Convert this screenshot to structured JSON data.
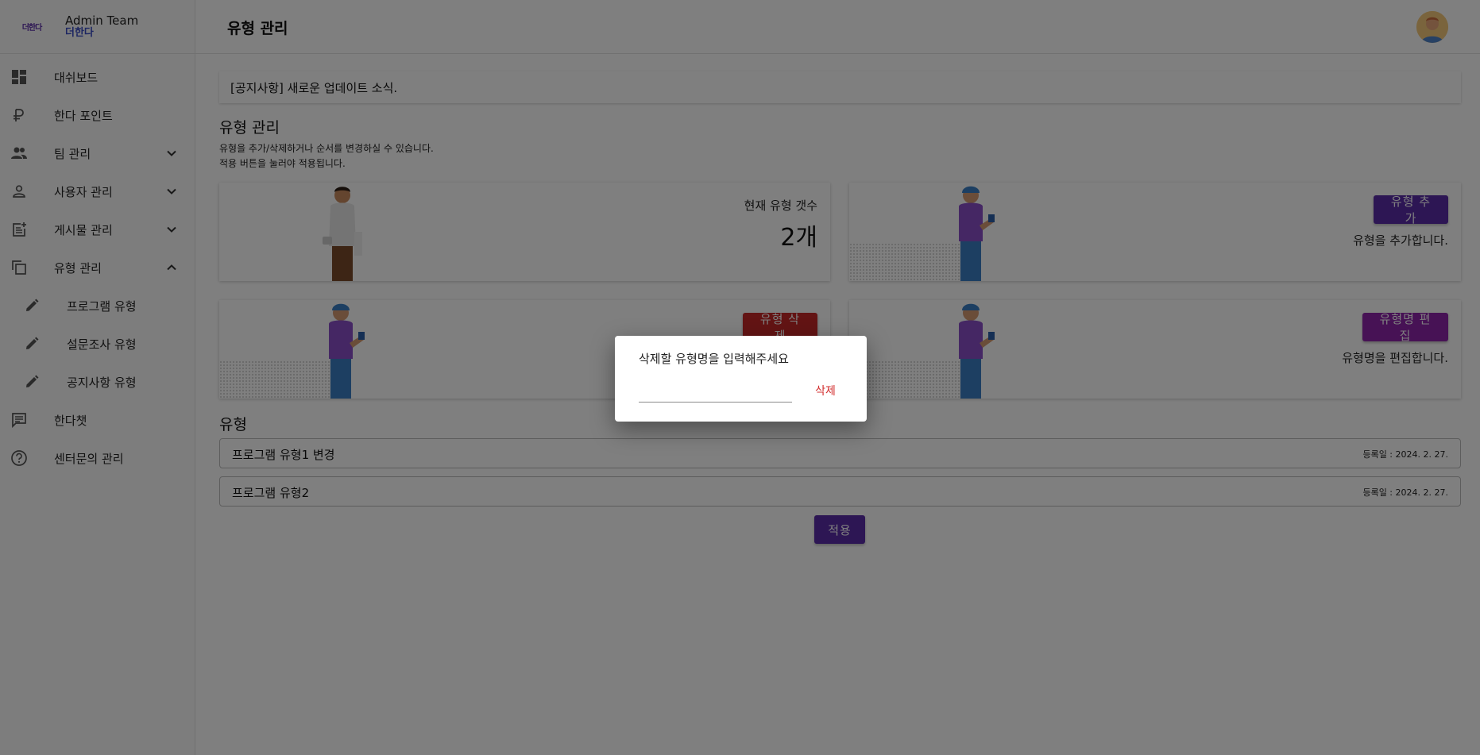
{
  "brand": {
    "logo_text": "더한다",
    "title": "Admin Team",
    "subtitle": "더한다"
  },
  "sidebar": {
    "items": [
      {
        "label": "대쉬보드",
        "icon": "dashboard-icon"
      },
      {
        "label": "한다 포인트",
        "icon": "ruble-icon"
      },
      {
        "label": "팀 관리",
        "icon": "people-icon",
        "expandable": true,
        "expanded": false
      },
      {
        "label": "사용자 관리",
        "icon": "person-icon",
        "expandable": true,
        "expanded": false
      },
      {
        "label": "게시물 관리",
        "icon": "post-add-icon",
        "expandable": true,
        "expanded": false
      },
      {
        "label": "유형 관리",
        "icon": "copy-icon",
        "expandable": true,
        "expanded": true
      },
      {
        "label": "프로그램 유형",
        "icon": "pencil-icon",
        "sub": true
      },
      {
        "label": "설문조사 유형",
        "icon": "pencil-icon",
        "sub": true
      },
      {
        "label": "공지사항 유형",
        "icon": "pencil-icon",
        "sub": true
      },
      {
        "label": "한다챗",
        "icon": "chat-icon"
      },
      {
        "label": "센터문의 관리",
        "icon": "help-icon"
      }
    ]
  },
  "header": {
    "title": "유형 관리"
  },
  "notice": {
    "text": "[공지사항] 새로운 업데이트 소식."
  },
  "section": {
    "title": "유형 관리",
    "desc_line1": "유형을 추가/삭제하거나 순서를 변경하실 수 있습니다.",
    "desc_line2": "적용 버튼을 눌러야 적용됩니다."
  },
  "cards": {
    "count": {
      "label": "현재 유형 갯수",
      "value": "2개"
    },
    "add": {
      "button": "유형 추가",
      "desc": "유형을 추가합니다."
    },
    "delete": {
      "button": "유형 삭제"
    },
    "edit": {
      "button": "유형명 편집",
      "desc": "유형명을 편집합니다."
    }
  },
  "types": {
    "title": "유형",
    "rows": [
      {
        "name": "프로그램 유형1 변경",
        "date": "등록일 : 2024. 2. 27."
      },
      {
        "name": "프로그램 유형2",
        "date": "등록일 : 2024. 2. 27."
      }
    ]
  },
  "apply_label": "적용",
  "dialog": {
    "title": "삭제할 유형명을 입력해주세요",
    "input_value": "",
    "input_placeholder": "",
    "delete_label": "삭제"
  },
  "colors": {
    "primary": "#5b2ca8",
    "danger": "#c62828",
    "edit": "#8e24aa",
    "brand_blue": "#3a4cc4"
  }
}
